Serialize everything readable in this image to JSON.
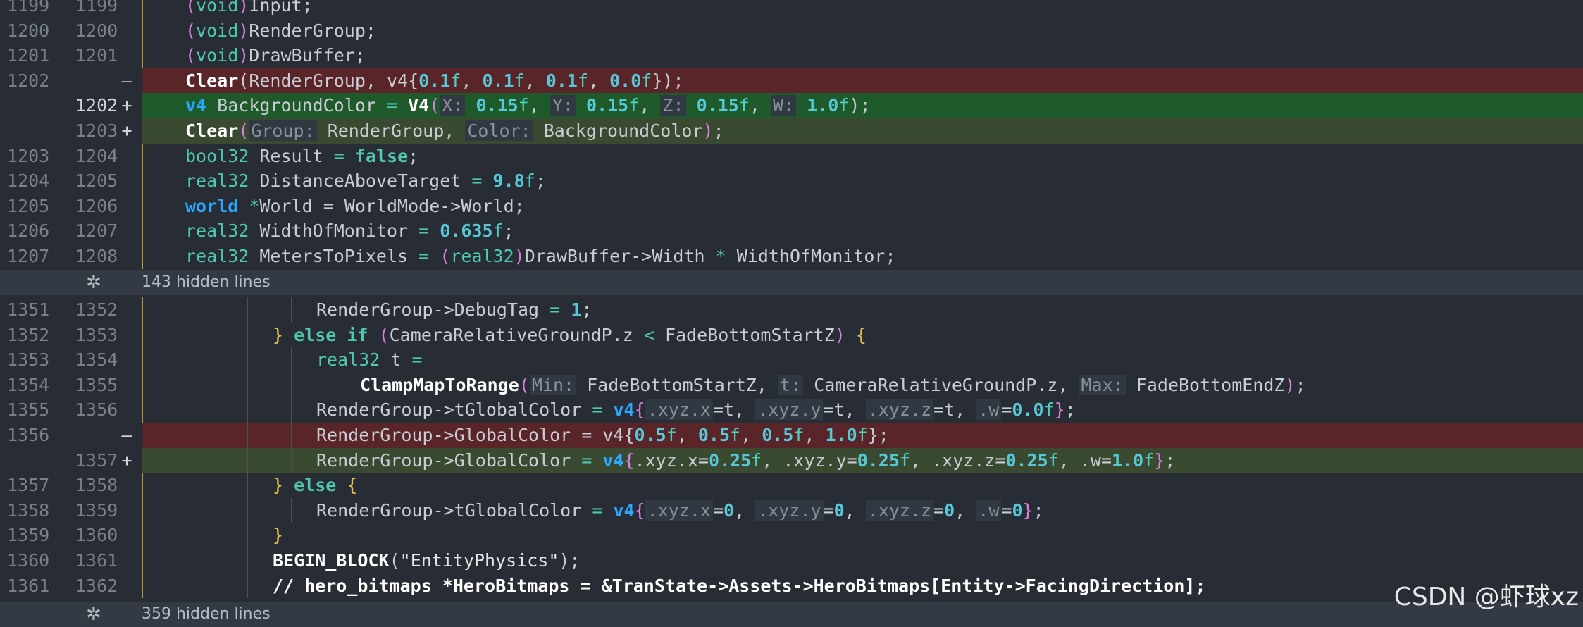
{
  "rows_top": [
    {
      "old": "1199",
      "new": "1199",
      "tokens": [
        {
          "t": "(",
          "c": "paren"
        },
        {
          "t": "void",
          "c": "ty"
        },
        {
          "t": ")",
          "c": "paren"
        },
        {
          "t": "Input;",
          "c": ""
        }
      ]
    },
    {
      "old": "1200",
      "new": "1200",
      "tokens": [
        {
          "t": "(",
          "c": "paren"
        },
        {
          "t": "void",
          "c": "ty"
        },
        {
          "t": ")",
          "c": "paren"
        },
        {
          "t": "RenderGroup;",
          "c": ""
        }
      ]
    },
    {
      "old": "1201",
      "new": "1201",
      "tokens": [
        {
          "t": "(",
          "c": "paren"
        },
        {
          "t": "void",
          "c": "ty"
        },
        {
          "t": ")",
          "c": "paren"
        },
        {
          "t": "DrawBuffer;",
          "c": ""
        }
      ]
    },
    {
      "old": "1202",
      "new": "",
      "sign": "—",
      "kind": "del",
      "tokens": [
        {
          "t": "Clear",
          "c": "fn"
        },
        {
          "t": "(RenderGroup, v4{",
          "c": ""
        },
        {
          "t": "0.1",
          "c": "num"
        },
        {
          "t": "f",
          "c": "suf"
        },
        {
          "t": ", ",
          "c": ""
        },
        {
          "t": "0.1",
          "c": "num"
        },
        {
          "t": "f",
          "c": "suf"
        },
        {
          "t": ", ",
          "c": ""
        },
        {
          "t": "0.1",
          "c": "num"
        },
        {
          "t": "f",
          "c": "suf"
        },
        {
          "t": ", ",
          "c": ""
        },
        {
          "t": "0.0",
          "c": "num"
        },
        {
          "t": "f",
          "c": "suf"
        },
        {
          "t": "});",
          "c": ""
        }
      ]
    },
    {
      "old": "",
      "new": "1202",
      "sign": "+",
      "kind": "add",
      "cur": true,
      "tokens": [
        {
          "t": "v4",
          "c": "kw"
        },
        {
          "t": " BackgroundColor ",
          "c": ""
        },
        {
          "t": "=",
          "c": "op"
        },
        {
          "t": " ",
          "c": ""
        },
        {
          "t": "V4",
          "c": "fn"
        },
        {
          "t": "(",
          "c": "paren"
        },
        {
          "t": "X:",
          "c": "hint"
        },
        {
          "t": " ",
          "c": ""
        },
        {
          "t": "0.15",
          "c": "num"
        },
        {
          "t": "f",
          "c": "suf"
        },
        {
          "t": ", ",
          "c": ""
        },
        {
          "t": "Y:",
          "c": "hint"
        },
        {
          "t": " ",
          "c": ""
        },
        {
          "t": "0.15",
          "c": "num"
        },
        {
          "t": "f",
          "c": "suf"
        },
        {
          "t": ", ",
          "c": ""
        },
        {
          "t": "Z:",
          "c": "hint"
        },
        {
          "t": " ",
          "c": ""
        },
        {
          "t": "0.15",
          "c": "num"
        },
        {
          "t": "f",
          "c": "suf"
        },
        {
          "t": ", ",
          "c": ""
        },
        {
          "t": "W:",
          "c": "hint"
        },
        {
          "t": " ",
          "c": ""
        },
        {
          "t": "1.0",
          "c": "num"
        },
        {
          "t": "f",
          "c": "suf"
        },
        {
          "t": ");",
          "c": ""
        }
      ]
    },
    {
      "old": "",
      "new": "1203",
      "sign": "+",
      "kind": "add2",
      "tokens": [
        {
          "t": "Clear",
          "c": "fn"
        },
        {
          "t": "(",
          "c": "paren"
        },
        {
          "t": "Group:",
          "c": "hint"
        },
        {
          "t": " RenderGroup, ",
          "c": ""
        },
        {
          "t": "Color:",
          "c": "hint"
        },
        {
          "t": " BackgroundColor",
          "c": ""
        },
        {
          "t": ")",
          "c": "paren"
        },
        {
          "t": ";",
          "c": ""
        }
      ]
    },
    {
      "old": "1203",
      "new": "1204",
      "tokens": [
        {
          "t": "bool32",
          "c": "ty"
        },
        {
          "t": " Result ",
          "c": ""
        },
        {
          "t": "=",
          "c": "op"
        },
        {
          "t": " ",
          "c": ""
        },
        {
          "t": "false",
          "c": "kw2"
        },
        {
          "t": ";",
          "c": ""
        }
      ]
    },
    {
      "old": "1204",
      "new": "1205",
      "tokens": [
        {
          "t": "real32",
          "c": "ty"
        },
        {
          "t": " DistanceAboveTarget ",
          "c": ""
        },
        {
          "t": "=",
          "c": "op"
        },
        {
          "t": " ",
          "c": ""
        },
        {
          "t": "9.8",
          "c": "num"
        },
        {
          "t": "f",
          "c": "suf"
        },
        {
          "t": ";",
          "c": ""
        }
      ]
    },
    {
      "old": "1205",
      "new": "1206",
      "tokens": [
        {
          "t": "world",
          "c": "kw"
        },
        {
          "t": " ",
          "c": ""
        },
        {
          "t": "*",
          "c": "op"
        },
        {
          "t": "World = WorldMode->World;",
          "c": ""
        }
      ]
    },
    {
      "old": "1206",
      "new": "1207",
      "tokens": [
        {
          "t": "real32",
          "c": "ty"
        },
        {
          "t": " WidthOfMonitor ",
          "c": ""
        },
        {
          "t": "=",
          "c": "op"
        },
        {
          "t": " ",
          "c": ""
        },
        {
          "t": "0.635",
          "c": "num"
        },
        {
          "t": "f",
          "c": "suf"
        },
        {
          "t": ";",
          "c": ""
        }
      ]
    },
    {
      "old": "1207",
      "new": "1208",
      "tokens": [
        {
          "t": "real32",
          "c": "ty"
        },
        {
          "t": " MetersToPixels ",
          "c": ""
        },
        {
          "t": "=",
          "c": "op"
        },
        {
          "t": " ",
          "c": ""
        },
        {
          "t": "(",
          "c": "paren"
        },
        {
          "t": "real32",
          "c": "ty"
        },
        {
          "t": ")",
          "c": "paren"
        },
        {
          "t": "DrawBuffer->Width ",
          "c": ""
        },
        {
          "t": "*",
          "c": "op"
        },
        {
          "t": " WidthOfMonitor;",
          "c": ""
        }
      ]
    }
  ],
  "fold1": "143 hidden lines",
  "rows_bottom": [
    {
      "old": "1351",
      "new": "1352",
      "indent": 3,
      "tokens": [
        {
          "t": "RenderGroup->DebugTag ",
          "c": ""
        },
        {
          "t": "=",
          "c": "op"
        },
        {
          "t": " ",
          "c": ""
        },
        {
          "t": "1",
          "c": "num"
        },
        {
          "t": ";",
          "c": ""
        }
      ]
    },
    {
      "old": "1352",
      "new": "1353",
      "indent": 2,
      "tokens": [
        {
          "t": "}",
          "c": "brace"
        },
        {
          "t": " ",
          "c": ""
        },
        {
          "t": "else if",
          "c": "kw2"
        },
        {
          "t": " ",
          "c": ""
        },
        {
          "t": "(",
          "c": "paren"
        },
        {
          "t": "CameraRelativeGroundP.z ",
          "c": ""
        },
        {
          "t": "<",
          "c": "op"
        },
        {
          "t": " FadeBottomStartZ",
          "c": ""
        },
        {
          "t": ")",
          "c": "paren"
        },
        {
          "t": " ",
          "c": ""
        },
        {
          "t": "{",
          "c": "brace"
        }
      ]
    },
    {
      "old": "1353",
      "new": "1354",
      "indent": 3,
      "tokens": [
        {
          "t": "real32",
          "c": "ty"
        },
        {
          "t": " t ",
          "c": ""
        },
        {
          "t": "=",
          "c": "op"
        }
      ]
    },
    {
      "old": "1354",
      "new": "1355",
      "indent": 4,
      "tokens": [
        {
          "t": "ClampMapToRange",
          "c": "fn"
        },
        {
          "t": "(",
          "c": "paren"
        },
        {
          "t": "Min:",
          "c": "hint"
        },
        {
          "t": " FadeBottomStartZ, ",
          "c": ""
        },
        {
          "t": "t:",
          "c": "hint"
        },
        {
          "t": " CameraRelativeGroundP.z, ",
          "c": ""
        },
        {
          "t": "Max:",
          "c": "hint"
        },
        {
          "t": " FadeBottomEndZ",
          "c": ""
        },
        {
          "t": ")",
          "c": "paren"
        },
        {
          "t": ";",
          "c": ""
        }
      ]
    },
    {
      "old": "1355",
      "new": "1356",
      "indent": 3,
      "tokens": [
        {
          "t": "RenderGroup->tGlobalColor ",
          "c": ""
        },
        {
          "t": "=",
          "c": "op"
        },
        {
          "t": " ",
          "c": ""
        },
        {
          "t": "v4",
          "c": "kw"
        },
        {
          "t": "{",
          "c": "paren"
        },
        {
          "t": ".xyz.x",
          "c": "hint"
        },
        {
          "t": "=t, ",
          "c": ""
        },
        {
          "t": ".xyz.y",
          "c": "hint"
        },
        {
          "t": "=t, ",
          "c": ""
        },
        {
          "t": ".xyz.z",
          "c": "hint"
        },
        {
          "t": "=t, ",
          "c": ""
        },
        {
          "t": ".w",
          "c": "hint"
        },
        {
          "t": "=",
          "c": ""
        },
        {
          "t": "0.0",
          "c": "num"
        },
        {
          "t": "f",
          "c": "suf"
        },
        {
          "t": "}",
          "c": "paren"
        },
        {
          "t": ";",
          "c": ""
        }
      ]
    },
    {
      "old": "1356",
      "new": "",
      "sign": "—",
      "kind": "del",
      "indent": 3,
      "tokens": [
        {
          "t": "RenderGroup->GlobalColor = v4{",
          "c": ""
        },
        {
          "t": "0.5",
          "c": "num"
        },
        {
          "t": "f",
          "c": "suf"
        },
        {
          "t": ", ",
          "c": ""
        },
        {
          "t": "0.5",
          "c": "num"
        },
        {
          "t": "f",
          "c": "suf"
        },
        {
          "t": ", ",
          "c": ""
        },
        {
          "t": "0.5",
          "c": "num"
        },
        {
          "t": "f",
          "c": "suf"
        },
        {
          "t": ", ",
          "c": ""
        },
        {
          "t": "1.0",
          "c": "num"
        },
        {
          "t": "f",
          "c": "suf"
        },
        {
          "t": "};",
          "c": ""
        }
      ]
    },
    {
      "old": "",
      "new": "1357",
      "sign": "+",
      "kind": "add2",
      "indent": 3,
      "tokens": [
        {
          "t": "RenderGroup->GlobalColor ",
          "c": ""
        },
        {
          "t": "=",
          "c": "op"
        },
        {
          "t": " ",
          "c": ""
        },
        {
          "t": "v4",
          "c": "kw"
        },
        {
          "t": "{",
          "c": "paren"
        },
        {
          "t": ".xyz.x=",
          "c": ""
        },
        {
          "t": "0.25",
          "c": "num"
        },
        {
          "t": "f",
          "c": "suf"
        },
        {
          "t": ", .xyz.y=",
          "c": ""
        },
        {
          "t": "0.25",
          "c": "num"
        },
        {
          "t": "f",
          "c": "suf"
        },
        {
          "t": ", .xyz.z=",
          "c": ""
        },
        {
          "t": "0.25",
          "c": "num"
        },
        {
          "t": "f",
          "c": "suf"
        },
        {
          "t": ", .w=",
          "c": ""
        },
        {
          "t": "1.0",
          "c": "num"
        },
        {
          "t": "f",
          "c": "suf"
        },
        {
          "t": "}",
          "c": "paren"
        },
        {
          "t": ";",
          "c": ""
        }
      ]
    },
    {
      "old": "1357",
      "new": "1358",
      "indent": 2,
      "tokens": [
        {
          "t": "}",
          "c": "brace"
        },
        {
          "t": " ",
          "c": ""
        },
        {
          "t": "else",
          "c": "kw2"
        },
        {
          "t": " ",
          "c": ""
        },
        {
          "t": "{",
          "c": "brace"
        }
      ]
    },
    {
      "old": "1358",
      "new": "1359",
      "indent": 3,
      "tokens": [
        {
          "t": "RenderGroup->tGlobalColor ",
          "c": ""
        },
        {
          "t": "=",
          "c": "op"
        },
        {
          "t": " ",
          "c": ""
        },
        {
          "t": "v4",
          "c": "kw"
        },
        {
          "t": "{",
          "c": "paren"
        },
        {
          "t": ".xyz.x",
          "c": "hint"
        },
        {
          "t": "=",
          "c": ""
        },
        {
          "t": "0",
          "c": "num"
        },
        {
          "t": ", ",
          "c": ""
        },
        {
          "t": ".xyz.y",
          "c": "hint"
        },
        {
          "t": "=",
          "c": ""
        },
        {
          "t": "0",
          "c": "num"
        },
        {
          "t": ", ",
          "c": ""
        },
        {
          "t": ".xyz.z",
          "c": "hint"
        },
        {
          "t": "=",
          "c": ""
        },
        {
          "t": "0",
          "c": "num"
        },
        {
          "t": ", ",
          "c": ""
        },
        {
          "t": ".w",
          "c": "hint"
        },
        {
          "t": "=",
          "c": ""
        },
        {
          "t": "0",
          "c": "num"
        },
        {
          "t": "}",
          "c": "paren"
        },
        {
          "t": ";",
          "c": ""
        }
      ]
    },
    {
      "old": "1359",
      "new": "1360",
      "indent": 2,
      "tokens": [
        {
          "t": "}",
          "c": "brace"
        }
      ]
    },
    {
      "old": "1360",
      "new": "1361",
      "indent": 2,
      "tokens": [
        {
          "t": "BEGIN_BLOCK",
          "c": "fn"
        },
        {
          "t": "(",
          "c": ""
        },
        {
          "t": "\"EntityPhysics\"",
          "c": "str"
        },
        {
          "t": ");",
          "c": ""
        }
      ]
    },
    {
      "old": "1361",
      "new": "1362",
      "indent": 2,
      "tokens": [
        {
          "t": "// hero_bitmaps *HeroBitmaps = &TranState->Assets->HeroBitmaps[Entity->FacingDirection];",
          "c": "cm"
        }
      ]
    }
  ],
  "fold2": "359 hidden lines",
  "watermark": "CSDN @虾球xz"
}
